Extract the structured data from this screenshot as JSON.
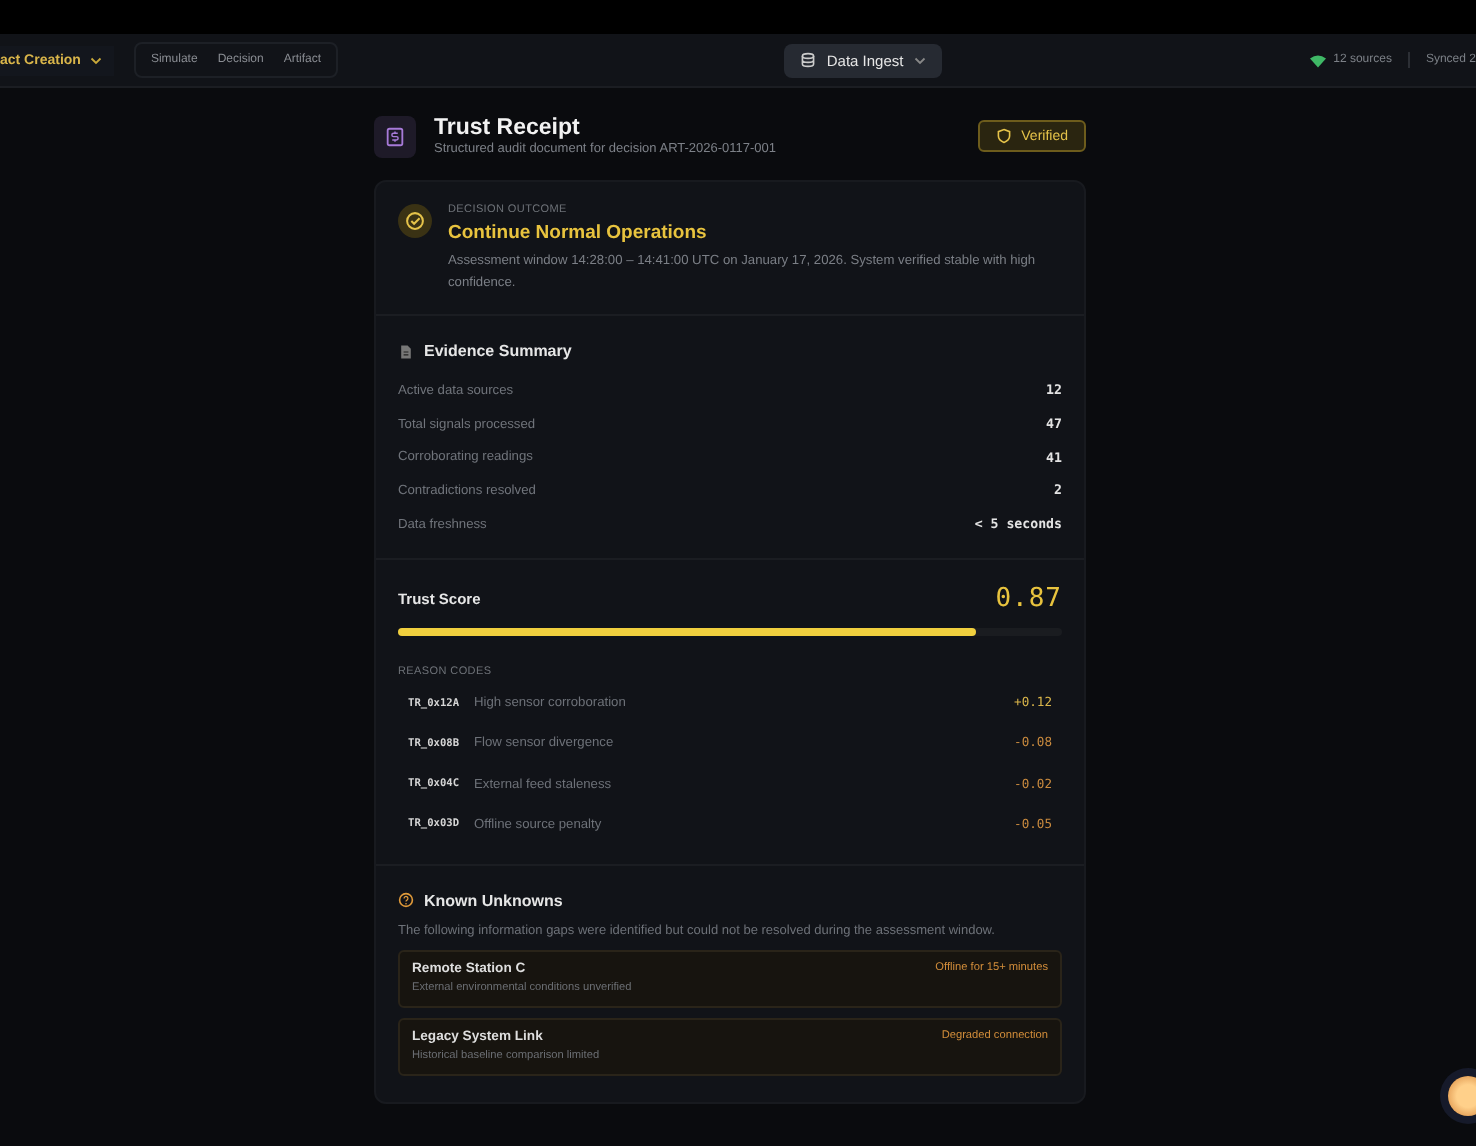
{
  "nav": {
    "mode": "act Creation",
    "tabs": [
      {
        "label": "Simulate",
        "selected": false
      },
      {
        "label": "Decision",
        "selected": false
      },
      {
        "label": "Artifact",
        "selected": false
      }
    ],
    "source": "Data Ingest",
    "sources": "12 sources",
    "synced": "Synced 2"
  },
  "header": {
    "title": "Trust Receipt",
    "subtitle": "Structured audit document for decision ART-2026-0117-001",
    "badge": "Verified"
  },
  "outcome": {
    "eyebrow": "DECISION OUTCOME",
    "title": "Continue Normal Operations",
    "text": "Assessment window 14:28:00 – 14:41:00 UTC on January 17, 2026. System verified stable with high confidence."
  },
  "evidence": {
    "title": "Evidence Summary",
    "rows": [
      {
        "label": "Active data sources",
        "value": "12"
      },
      {
        "label": "Total signals processed",
        "value": "47"
      },
      {
        "label": "Corroborating readings",
        "value": "41"
      },
      {
        "label": "Contradictions resolved",
        "value": "2"
      },
      {
        "label": "Data freshness",
        "value": "< 5 seconds"
      }
    ]
  },
  "trust": {
    "title": "Trust Score",
    "score": "0.87",
    "level": 0.87,
    "codes_title": "REASON CODES",
    "codes": [
      {
        "code": "TR_0x12A",
        "label": "High sensor corroboration",
        "delta": "+0.12",
        "color": "#d9b54a"
      },
      {
        "code": "TR_0x08B",
        "label": "Flow sensor divergence",
        "delta": "-0.08",
        "color": "#c98a3e"
      },
      {
        "code": "TR_0x04C",
        "label": "External feed staleness",
        "delta": "-0.02",
        "color": "#c98a3e"
      },
      {
        "code": "TR_0x03D",
        "label": "Offline source penalty",
        "delta": "-0.05",
        "color": "#c98a3e"
      }
    ]
  },
  "unknowns": {
    "title": "Known Unknowns",
    "text": "The following information gaps were identified but could not be resolved during the assessment window.",
    "items": [
      {
        "name": "Remote Station C",
        "detail": "External environmental conditions unverified",
        "status": "Offline for 15+ minutes"
      },
      {
        "name": "Legacy System Link",
        "detail": "Historical baseline comparison limited",
        "status": "Degraded connection"
      }
    ]
  }
}
